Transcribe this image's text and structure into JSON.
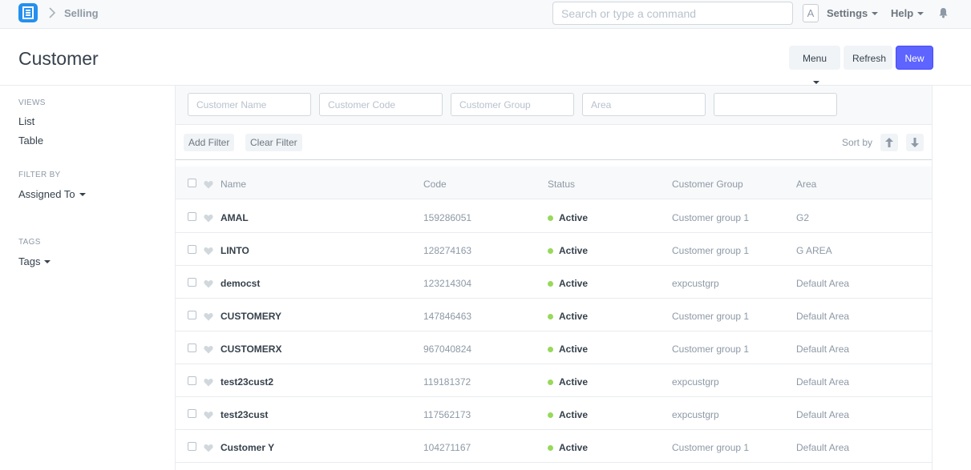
{
  "navbar": {
    "breadcrumb": "Selling",
    "search_placeholder": "Search or type a command",
    "avatar_letter": "A",
    "settings_label": "Settings",
    "help_label": "Help"
  },
  "page": {
    "title": "Customer",
    "menu_label": "Menu",
    "refresh_label": "Refresh",
    "new_label": "New"
  },
  "sidebar": {
    "views_heading": "VIEWS",
    "views": [
      "List",
      "Table"
    ],
    "filter_heading": "FILTER BY",
    "assigned_to_label": "Assigned To",
    "tags_heading": "TAGS",
    "tags_label": "Tags"
  },
  "filters": {
    "customer_name_placeholder": "Customer Name",
    "customer_code_placeholder": "Customer Code",
    "customer_group_placeholder": "Customer Group",
    "area_placeholder": "Area",
    "extra_placeholder": "",
    "add_filter_label": "Add Filter",
    "clear_filter_label": "Clear Filter",
    "sort_label": "Sort by"
  },
  "table": {
    "columns": [
      "Name",
      "Code",
      "Status",
      "Customer Group",
      "Area"
    ],
    "rows": [
      {
        "name": "AMAL",
        "code": "159286051",
        "status": "Active",
        "group": "Customer group 1",
        "area": "G2"
      },
      {
        "name": "LINTO",
        "code": "128274163",
        "status": "Active",
        "group": "Customer group 1",
        "area": "G AREA"
      },
      {
        "name": "democst",
        "code": "123214304",
        "status": "Active",
        "group": "expcustgrp",
        "area": "Default Area"
      },
      {
        "name": "CUSTOMERY",
        "code": "147846463",
        "status": "Active",
        "group": "Customer group 1",
        "area": "Default Area"
      },
      {
        "name": "CUSTOMERX",
        "code": "967040824",
        "status": "Active",
        "group": "Customer group 1",
        "area": "Default Area"
      },
      {
        "name": "test23cust2",
        "code": "119181372",
        "status": "Active",
        "group": "expcustgrp",
        "area": "Default Area"
      },
      {
        "name": "test23cust",
        "code": "117562173",
        "status": "Active",
        "group": "expcustgrp",
        "area": "Default Area"
      },
      {
        "name": "Customer Y",
        "code": "104271167",
        "status": "Active",
        "group": "Customer group 1",
        "area": "Default Area"
      }
    ]
  },
  "colors": {
    "accent": "#5e64ff",
    "logo": "#2490ef",
    "status_active": "#98d85b"
  },
  "icons": {
    "logo": "app-logo-icon",
    "breadcrumb_separator": "chevron-right-icon",
    "notifications": "bell-icon",
    "like": "heart-icon",
    "sort_ascending": "arrow-up-icon",
    "sort_descending": "arrow-down-icon"
  }
}
